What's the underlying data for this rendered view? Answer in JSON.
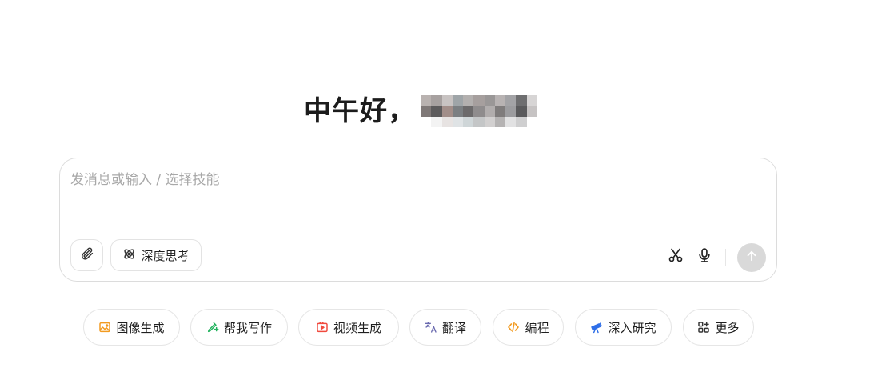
{
  "greeting": {
    "text": "中午好，"
  },
  "composer": {
    "placeholder": "发消息或输入 / 选择技能",
    "deep_think_label": "深度思考"
  },
  "skills": [
    {
      "label": "图像生成",
      "icon": "image-generate-icon",
      "color": "#f29a1f"
    },
    {
      "label": "帮我写作",
      "icon": "pen-write-icon",
      "color": "#22b35e"
    },
    {
      "label": "视频生成",
      "icon": "video-play-icon",
      "color": "#f04a3e"
    },
    {
      "label": "翻译",
      "icon": "translate-icon",
      "color": "#6b6bb0"
    },
    {
      "label": "编程",
      "icon": "code-icon",
      "color": "#f29a1f"
    },
    {
      "label": "深入研究",
      "icon": "telescope-icon",
      "color": "#2f6fe8"
    },
    {
      "label": "更多",
      "icon": "grid-plus-icon",
      "color": "#333333"
    }
  ],
  "colors": {
    "send_disabled": "#d9d9d9",
    "border": "#dcdcdc",
    "placeholder": "#a8a8a8"
  }
}
